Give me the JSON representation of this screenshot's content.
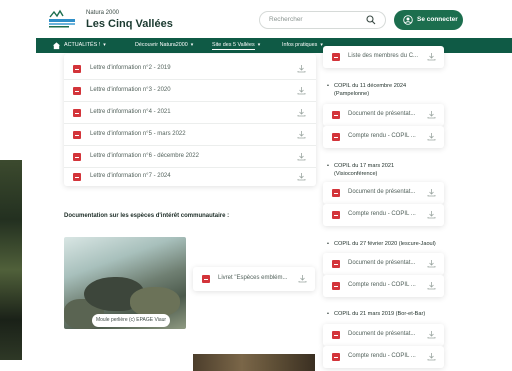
{
  "header": {
    "logo_subtitle": "Natura 2000",
    "logo_title": "Les Cinq Vallées",
    "search_placeholder": "Rechercher",
    "login_label": "Se connecter"
  },
  "nav": {
    "items": [
      {
        "label": "ACTUALITÉS !"
      },
      {
        "label": "Découvrir Natura2000"
      },
      {
        "label": "Site des 5 Vallées"
      },
      {
        "label": "Infos pratiques"
      }
    ]
  },
  "newsletters": [
    {
      "label": "Lettre d'information n°2 - 2019"
    },
    {
      "label": "Lettre d'information n°3 - 2020"
    },
    {
      "label": "Lettre d'information n°4 - 2021"
    },
    {
      "label": "Lettre d'information n°5 - mars 2022"
    },
    {
      "label": "Lettre d'information n°6 - décembre 2022"
    },
    {
      "label": "Lettre d'information n°7 - 2024"
    }
  ],
  "species": {
    "section_title": "Documentation sur les espèces d'intérêt communautaire :",
    "photo_caption": "Moule perlière (c) EPAGE Viaur",
    "livret_label": "Livret \"Espèces emblém..."
  },
  "copil": {
    "top_doc": "Liste des membres du C...",
    "meetings": [
      {
        "title_line1": "COPIL du 11 décembre 2024",
        "title_line2": "(Pampelonne)",
        "doc1": "Document de présentat...",
        "doc2": "Compte rendu - COPIL ..."
      },
      {
        "title_line1": "COPIL du 17 mars 2021",
        "title_line2": "(Visioconférence)",
        "doc1": "Document de présentat...",
        "doc2": "Compte rendu - COPIL ..."
      },
      {
        "title_line1": "COPIL du 27 février 2020 (lescure-Jaoul)",
        "title_line2": "",
        "doc1": "Document de présentat...",
        "doc2": "Compte rendu - COPIL ..."
      },
      {
        "title_line1": "COPIL du 21 mars 2019 (Bor-et-Bar)",
        "title_line2": "",
        "doc1": "Document de présentat...",
        "doc2": "Compte rendu - COPIL ..."
      }
    ]
  },
  "colors": {
    "primary": "#0f5a45",
    "button": "#1c6e4e",
    "pdf": "#d3343a"
  }
}
